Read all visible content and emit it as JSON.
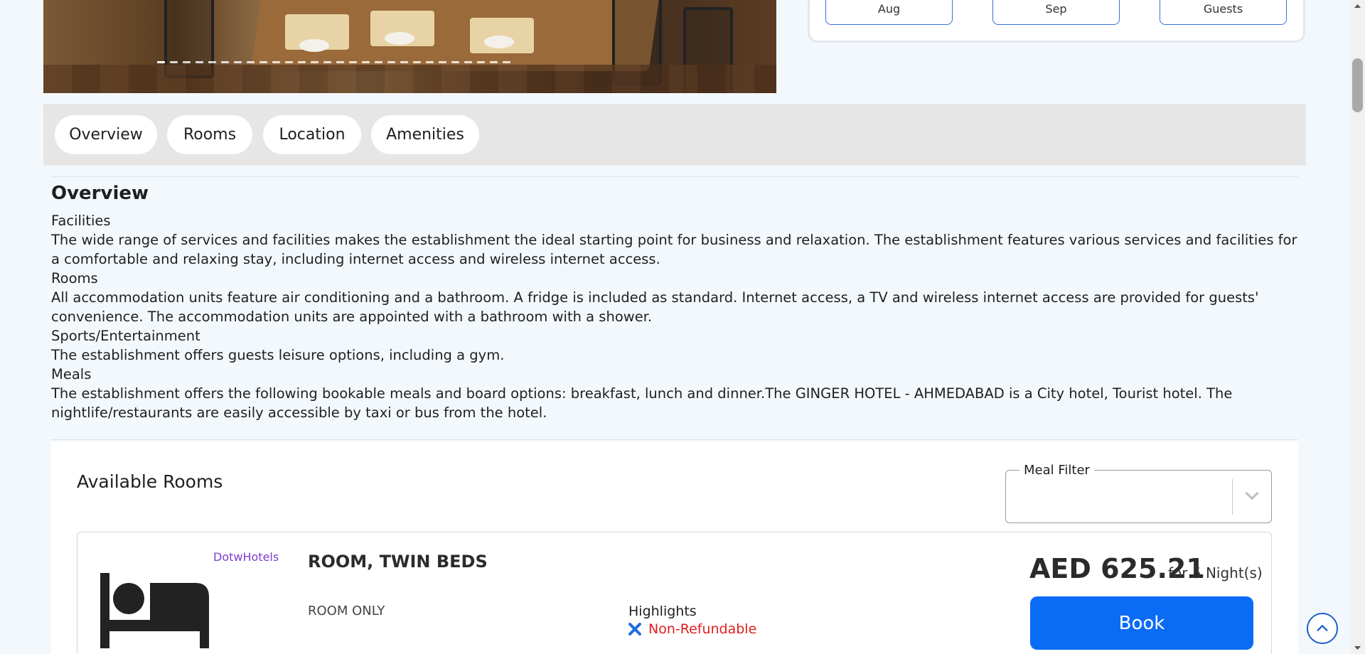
{
  "search": {
    "check_in_month": "Aug",
    "check_out_month": "Sep",
    "guests_label": "Guests"
  },
  "tabs": [
    {
      "label": "Overview"
    },
    {
      "label": "Rooms"
    },
    {
      "label": "Location"
    },
    {
      "label": "Amenities"
    }
  ],
  "overview": {
    "title": "Overview",
    "paragraphs": [
      "Facilities",
      "The wide range of services and facilities makes the establishment the ideal starting point for business and relaxation. The establishment features various services and facilities for a comfortable and relaxing stay, including internet access and wireless internet access.",
      "Rooms",
      "All accommodation units feature air conditioning and a bathroom. A fridge is included as standard. Internet access, a TV and wireless internet access are provided for guests' convenience. The accommodation units are appointed with a bathroom with a shower.",
      "Sports/Entertainment",
      "The establishment offers guests leisure options, including a gym.",
      "Meals",
      "The establishment offers the following bookable meals and board options: breakfast, lunch and dinner.The GINGER HOTEL - AHMEDABAD is a City hotel, Tourist hotel. The nightlife/restaurants are easily accessible by taxi or bus from the hotel."
    ]
  },
  "rooms": {
    "title": "Available Rooms",
    "meal_filter_label": "Meal Filter",
    "meal_filter_value": "",
    "items": [
      {
        "source": "DotwHotels",
        "name": "ROOM, TWIN BEDS",
        "board": "ROOM ONLY",
        "highlights_label": "Highlights",
        "refund_policy": "Non-Refundable",
        "price": "AED 625.21",
        "nights": "for 5 Night(s)",
        "book_label": "Book"
      }
    ]
  },
  "colors": {
    "accent": "#0a6cf5",
    "refund_red": "#e11d1d",
    "source_purple": "#7a3fd0"
  },
  "icons": {
    "room": "bed-icon",
    "refund": "x-icon",
    "meal_filter": "chevron-down-icon",
    "back_to_top": "chevron-up-icon"
  }
}
